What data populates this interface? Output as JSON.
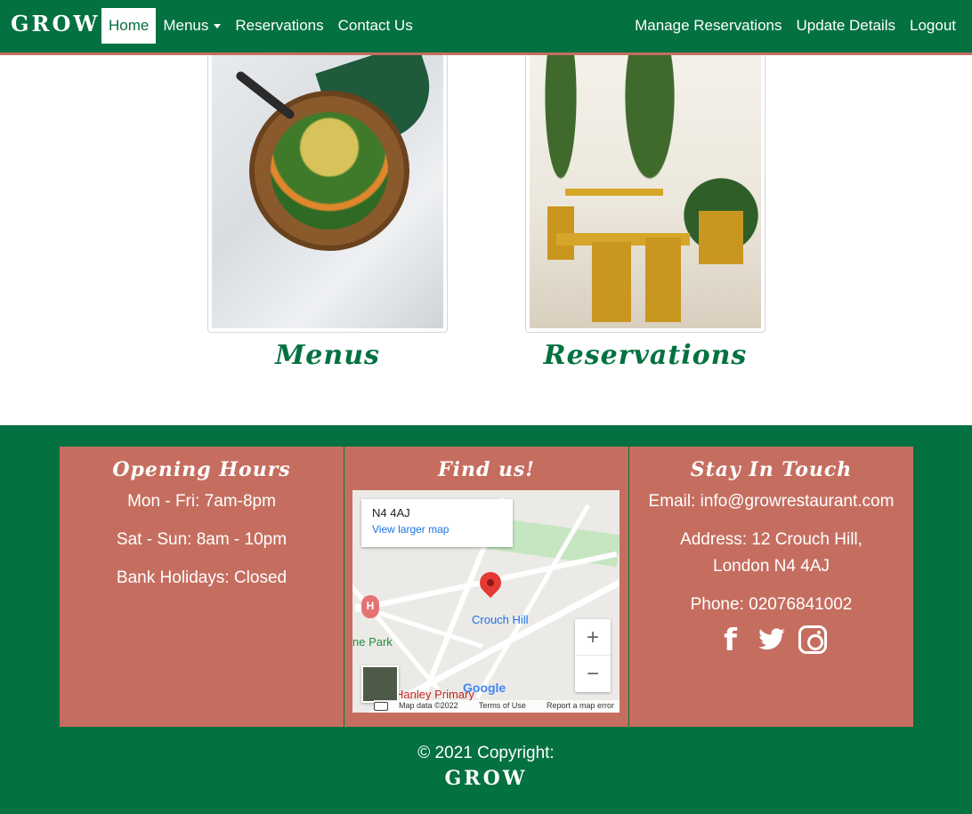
{
  "brand": "GROW",
  "nav": {
    "left": [
      {
        "label": "Home",
        "active": true
      },
      {
        "label": "Menus",
        "dropdown": true
      },
      {
        "label": "Reservations"
      },
      {
        "label": "Contact Us"
      }
    ],
    "right": [
      {
        "label": "Manage Reservations"
      },
      {
        "label": "Update Details"
      },
      {
        "label": "Logout"
      }
    ]
  },
  "cards": {
    "menus_caption": "Menus",
    "reservations_caption": "Reservations"
  },
  "footer": {
    "hours": {
      "title": "Opening Hours",
      "lines": [
        "Mon - Fri: 7am-8pm",
        "Sat - Sun: 8am - 10pm",
        "Bank Holidays: Closed"
      ]
    },
    "find": {
      "title": "Find us!",
      "map": {
        "place": "N4 4AJ",
        "link": "View larger map",
        "station": "Crouch Hill",
        "park": "ne Park",
        "school": "Hanley Primary",
        "logo": "Google",
        "attribution": [
          "Map data ©2022",
          "Terms of Use",
          "Report a map error"
        ],
        "zoom_in": "+",
        "zoom_out": "−",
        "hospital": "H"
      }
    },
    "touch": {
      "title": "Stay In Touch",
      "email": "Email: info@growrestaurant.com",
      "address": "Address: 12 Crouch Hill, London N4 4AJ",
      "phone": "Phone: 02076841002",
      "social": [
        "facebook-icon",
        "twitter-icon",
        "instagram-icon"
      ]
    },
    "copyright": "© 2021 Copyright:",
    "brand": "GROW"
  },
  "colors": {
    "primary_green": "#037140",
    "panel_terracotta": "#c56e60",
    "white": "#ffffff"
  }
}
